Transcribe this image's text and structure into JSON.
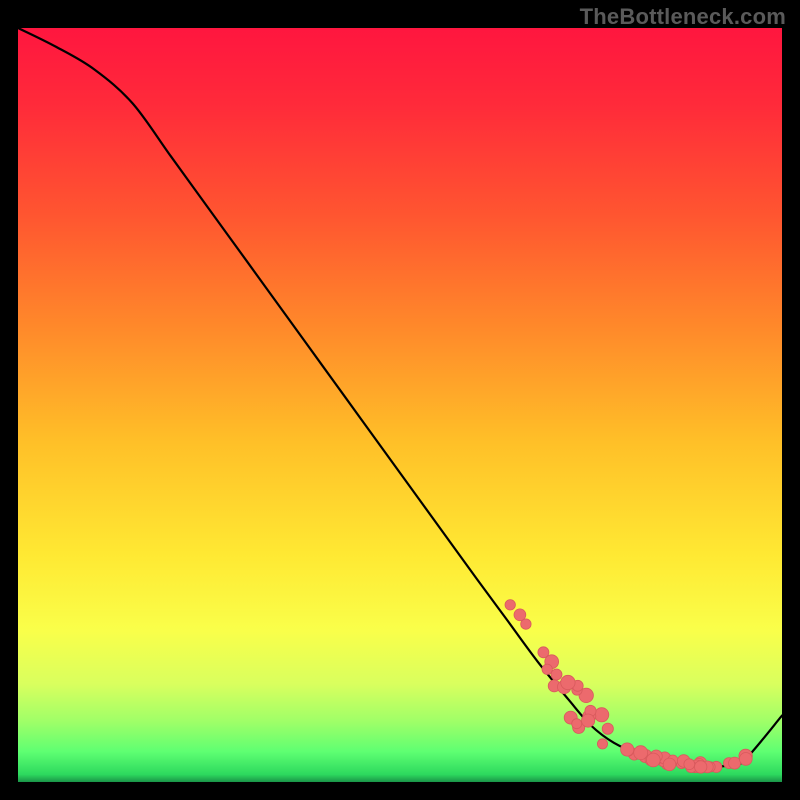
{
  "brand": "TheBottleneck.com",
  "chart_data": {
    "type": "line",
    "title": "",
    "xlabel": "",
    "ylabel": "",
    "x": [
      0,
      5,
      10,
      15,
      20,
      25,
      30,
      35,
      40,
      45,
      50,
      55,
      60,
      64,
      68,
      72,
      75,
      78,
      82,
      86,
      89,
      91,
      93,
      95,
      100
    ],
    "y": [
      100,
      97.5,
      94.5,
      90,
      83,
      76,
      69,
      62,
      55,
      48,
      41,
      34,
      27,
      21.5,
      16,
      11,
      7.5,
      5.2,
      3.4,
      2.4,
      2.0,
      2.0,
      2.2,
      2.8,
      8.8
    ],
    "xlim": [
      0,
      100
    ],
    "ylim": [
      0,
      100
    ],
    "background_gradient": {
      "direction": "vertical",
      "stops": [
        {
          "pct": 0,
          "color": "#ff163f"
        },
        {
          "pct": 25,
          "color": "#ff5630"
        },
        {
          "pct": 55,
          "color": "#ffc028"
        },
        {
          "pct": 80,
          "color": "#f9ff4a"
        },
        {
          "pct": 96,
          "color": "#5eff72"
        },
        {
          "pct": 100,
          "color": "#1a9448"
        }
      ]
    },
    "dots": {
      "color": "#ec6a6d",
      "clusters": [
        {
          "x_range": [
            64,
            78
          ],
          "y_range": [
            5,
            22
          ],
          "count": 22
        },
        {
          "x_range": [
            78,
            92
          ],
          "y_range": [
            2,
            5
          ],
          "count": 28
        },
        {
          "x_range": [
            92,
            96
          ],
          "y_range": [
            2.5,
            4.5
          ],
          "count": 6
        }
      ]
    }
  }
}
